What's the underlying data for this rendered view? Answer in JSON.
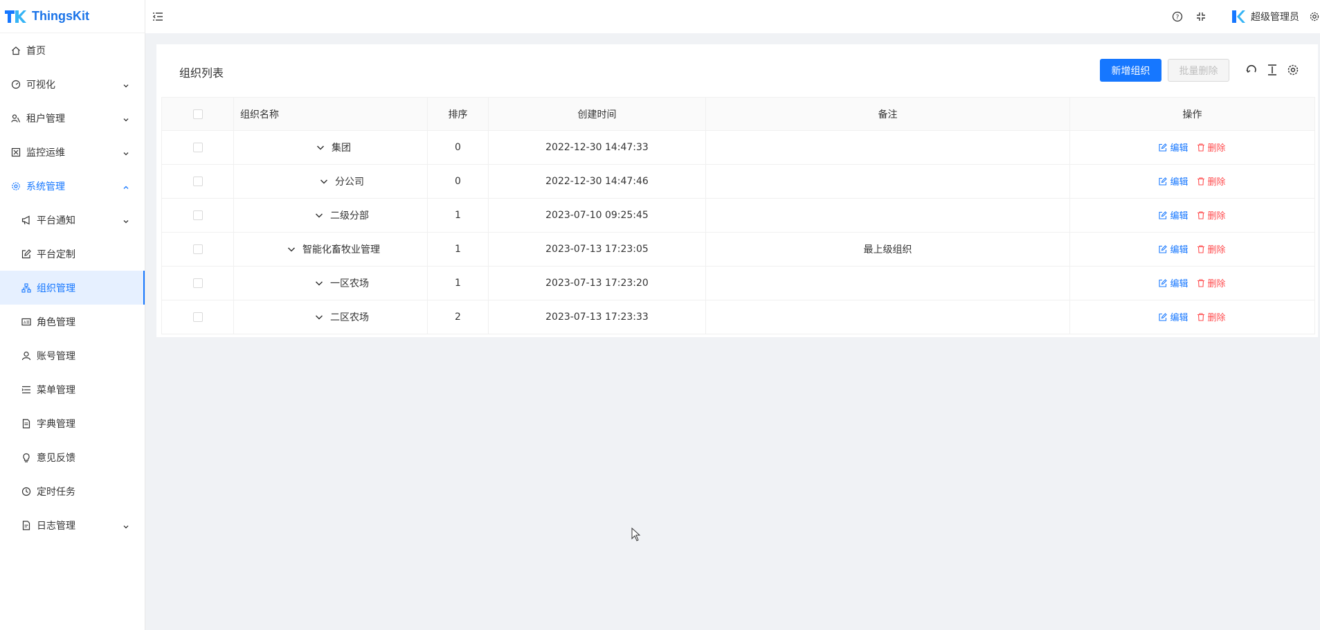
{
  "app": {
    "name": "ThingsKit",
    "brand_color": "#1677ff"
  },
  "sidebar": {
    "items": [
      {
        "label": "首页",
        "icon": "home-icon",
        "expandable": false
      },
      {
        "label": "可视化",
        "icon": "dashboard-icon",
        "expandable": true
      },
      {
        "label": "租户管理",
        "icon": "tenant-icon",
        "expandable": true
      },
      {
        "label": "监控运维",
        "icon": "monitor-icon",
        "expandable": true
      },
      {
        "label": "系统管理",
        "icon": "settings-icon",
        "expandable": true,
        "open": true
      },
      {
        "label": "平台通知",
        "icon": "megaphone-icon",
        "expandable": true,
        "sub": true
      },
      {
        "label": "平台定制",
        "icon": "edit-icon",
        "sub": true
      },
      {
        "label": "组织管理",
        "icon": "org-icon",
        "sub": true,
        "active": true
      },
      {
        "label": "角色管理",
        "icon": "id-card-icon",
        "sub": true
      },
      {
        "label": "账号管理",
        "icon": "user-icon",
        "sub": true
      },
      {
        "label": "菜单管理",
        "icon": "menu-list-icon",
        "sub": true
      },
      {
        "label": "字典管理",
        "icon": "file-icon",
        "sub": true
      },
      {
        "label": "意见反馈",
        "icon": "bulb-icon",
        "sub": true
      },
      {
        "label": "定时任务",
        "icon": "clock-icon",
        "sub": true
      },
      {
        "label": "日志管理",
        "icon": "log-icon",
        "sub": true,
        "expandable": true
      }
    ]
  },
  "header": {
    "username": "超级管理员"
  },
  "card": {
    "title": "组织列表",
    "add_button": "新增组织",
    "batch_delete_button": "批量删除"
  },
  "table": {
    "columns": [
      "组织名称",
      "排序",
      "创建时间",
      "备注",
      "操作"
    ],
    "edit_label": "编辑",
    "delete_label": "删除",
    "rows": [
      {
        "name": "集团",
        "order": "0",
        "created": "2022-12-30 14:47:33",
        "remark": "",
        "level": 0
      },
      {
        "name": "分公司",
        "order": "0",
        "created": "2022-12-30 14:47:46",
        "remark": "",
        "level": 1
      },
      {
        "name": "二级分部",
        "order": "1",
        "created": "2023-07-10 09:25:45",
        "remark": "",
        "level": 1
      },
      {
        "name": "智能化畜牧业管理",
        "order": "1",
        "created": "2023-07-13 17:23:05",
        "remark": "最上级组织",
        "level": 0
      },
      {
        "name": "一区农场",
        "order": "1",
        "created": "2023-07-13 17:23:20",
        "remark": "",
        "level": 1
      },
      {
        "name": "二区农场",
        "order": "2",
        "created": "2023-07-13 17:23:33",
        "remark": "",
        "level": 1
      }
    ]
  }
}
